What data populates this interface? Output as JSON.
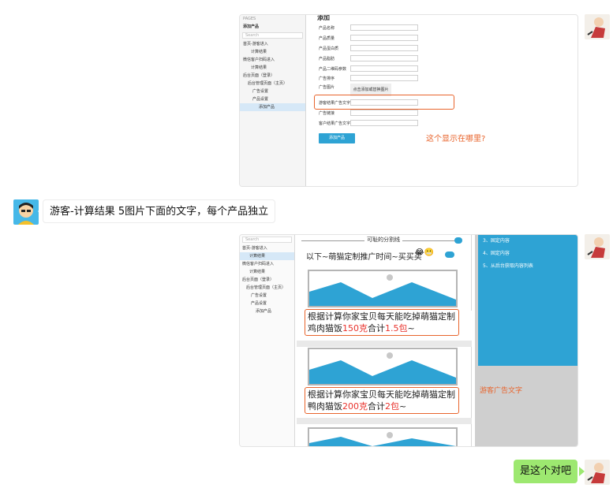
{
  "messages": {
    "msg2_text": "游客-计算结果 5图片下面的文字，每个产品独立",
    "msg4_text": "是这个对吧"
  },
  "shot1": {
    "pages_header": "PAGES",
    "selected_page": "添加产品",
    "search_placeholder": "Search",
    "tree": [
      "首页-游客进入",
      "计算结果",
      "微信客户扫码进入",
      "计算结果",
      "后台页面（登录）",
      "后台管理页面（主页）",
      "广告设置",
      "产品设置",
      "添加产品"
    ],
    "form_heading": "添加",
    "fields": [
      "产品名称",
      "产品质量",
      "产品蛋白质",
      "产品脂肪",
      "产品二维码参数",
      "广告排序",
      "广告图片"
    ],
    "upload_label": "点击添加或替换图片",
    "highlight_field": "游客结果广告文字",
    "field_link": "广告链接",
    "field_client": "客户结果广告文字",
    "add_button": "添加产品",
    "question": "这个显示在哪里?"
  },
  "shot2": {
    "search_placeholder": "Search",
    "tree": [
      "首页-游客进入",
      "计算结果",
      "微信客户扫码进入",
      "计算结果",
      "后台页面（登录）",
      "后台管理页面（主页）",
      "广告设置",
      "产品设置",
      "添加产品"
    ],
    "divider": "可耻的分割线",
    "promo": "以下~萌猫定制推广时间~买买买",
    "emoji": "😂😬",
    "block1_pre": "根据计算你家宝贝每天能吃掉萌猫定制鸡肉猫饭",
    "block1_amount": "150克",
    "block1_mid": "合计",
    "block1_packs": "1.5包",
    "block1_end": "~",
    "block2_pre": "根据计算你家宝贝每天能吃掉萌猫定制鸭肉猫饭",
    "block2_amount": "200克",
    "block2_mid": "合计",
    "block2_packs": "2包",
    "block2_end": "~",
    "right_items": [
      "3、固定内容",
      "4、固定内容",
      "5、从后台获取内容列表"
    ],
    "guest_ad_text": "游客广告文字"
  },
  "colors": {
    "accent_blue": "#2ea3d4",
    "orange": "#e8642c",
    "green_bubble": "#9de870"
  }
}
